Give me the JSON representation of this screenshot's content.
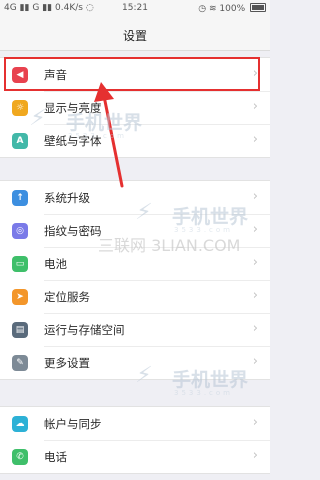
{
  "status_bar": {
    "signal_left": "4G",
    "signal_right": "G",
    "speed": "0.4K/s",
    "time": "15:21",
    "battery": "100%"
  },
  "title": "设置",
  "groups": [
    {
      "items": [
        {
          "label": "声音",
          "icon": "volume-icon",
          "color": "#e8424f",
          "glyph": "◀"
        },
        {
          "label": "显示与亮度",
          "icon": "brightness-icon",
          "color": "#f0a81f",
          "glyph": "☼"
        },
        {
          "label": "壁纸与字体",
          "icon": "wallpaper-icon",
          "color": "#42b8a8",
          "glyph": "A"
        }
      ]
    },
    {
      "items": [
        {
          "label": "系统升级",
          "icon": "system-update-icon",
          "color": "#3d8fe0",
          "glyph": "↑"
        },
        {
          "label": "指纹与密码",
          "icon": "fingerprint-icon",
          "color": "#7a7ae8",
          "glyph": "◎"
        },
        {
          "label": "电池",
          "icon": "battery-icon",
          "color": "#3fbf6a",
          "glyph": "▭"
        },
        {
          "label": "定位服务",
          "icon": "location-icon",
          "color": "#f3962a",
          "glyph": "➤"
        },
        {
          "label": "运行与存储空间",
          "icon": "storage-icon",
          "color": "#5a6b7c",
          "glyph": "▤"
        },
        {
          "label": "更多设置",
          "icon": "wrench-icon",
          "color": "#7d8a96",
          "glyph": "✎"
        }
      ]
    },
    {
      "items": [
        {
          "label": "帐户与同步",
          "icon": "cloud-sync-icon",
          "color": "#2db1d6",
          "glyph": "☁"
        },
        {
          "label": "电话",
          "icon": "phone-icon",
          "color": "#3fbf6a",
          "glyph": "✆"
        }
      ]
    }
  ],
  "watermarks": {
    "brand": "手机世界",
    "brand_sub": "3533.com",
    "site": "三联网 3LIAN.COM"
  },
  "highlight_color": "#e53030"
}
